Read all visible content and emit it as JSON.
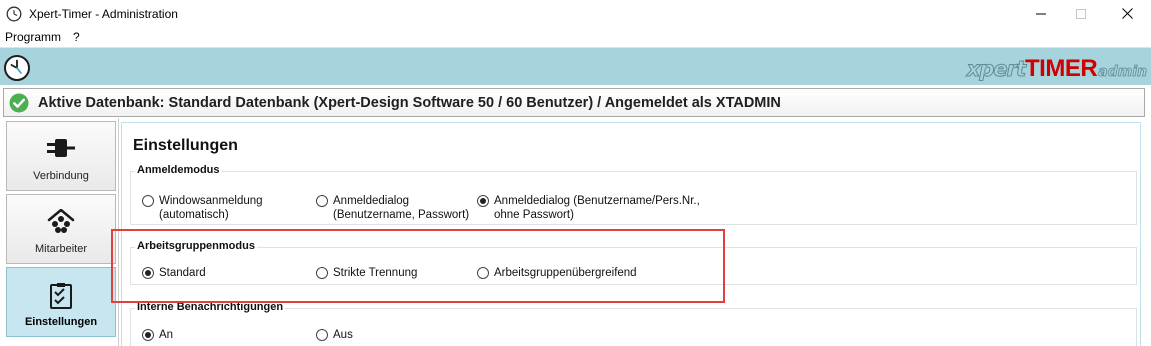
{
  "window": {
    "title": "Xpert-Timer - Administration",
    "controls": {
      "minimize": "—",
      "maximize": "☐",
      "close": "✕"
    }
  },
  "menu": {
    "items": [
      "Programm",
      "?"
    ]
  },
  "header": {
    "brand_xpert": "xpert",
    "brand_timer": "TIMER",
    "brand_admin": "admin",
    "band_color": "#a7d3dc"
  },
  "db_status": {
    "text": "Aktive Datenbank: Standard Datenbank (Xpert-Design Software 50 / 60 Benutzer) / Angemeldet als XTADMIN",
    "icon": "check-circle-icon",
    "icon_color": "#4caf50"
  },
  "nav": {
    "items": [
      {
        "label": "Verbindung",
        "icon": "plug-icon",
        "active": false
      },
      {
        "label": "Mitarbeiter",
        "icon": "people-icon",
        "active": false
      },
      {
        "label": "Einstellungen",
        "icon": "checklist-icon",
        "active": true
      }
    ]
  },
  "main": {
    "title": "Einstellungen",
    "groups": [
      {
        "title": "Anmeldemodus",
        "options": [
          {
            "label": "Windowsanmeldung\n(automatisch)",
            "checked": false
          },
          {
            "label": "Anmeldedialog\n(Benutzername, Passwort)",
            "checked": false
          },
          {
            "label": "Anmeldedialog (Benutzername/Pers.Nr.,\nohne Passwort)",
            "checked": true
          }
        ]
      },
      {
        "title": "Arbeitsgruppenmodus",
        "options": [
          {
            "label": "Standard",
            "checked": true
          },
          {
            "label": "Strikte Trennung",
            "checked": false
          },
          {
            "label": "Arbeitsgruppenübergreifend",
            "checked": false
          }
        ]
      },
      {
        "title": "Interne Benachrichtigungen",
        "options": [
          {
            "label": "An",
            "checked": true
          },
          {
            "label": "Aus",
            "checked": false
          }
        ]
      }
    ]
  },
  "colors": {
    "highlight": "#e0413c",
    "timer_red": "#d10000",
    "active_nav": "#c8e6ef"
  }
}
